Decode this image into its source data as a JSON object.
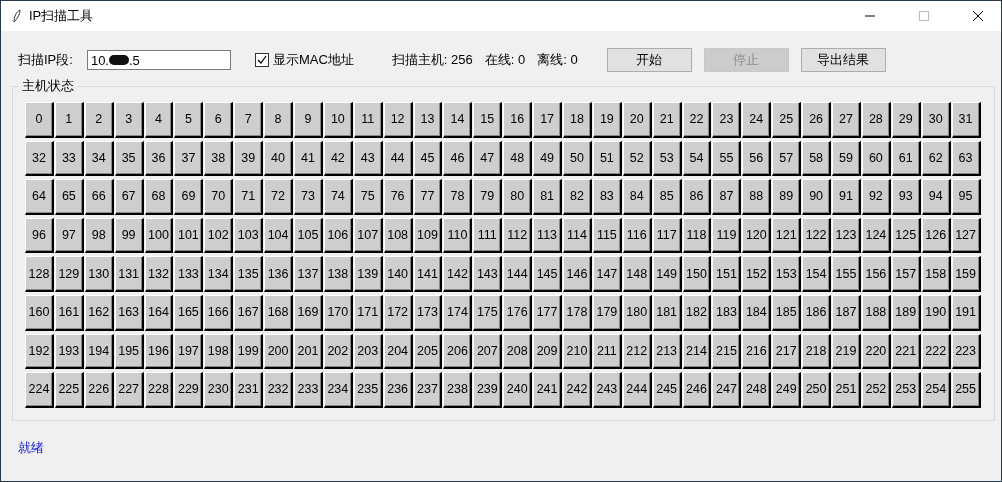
{
  "window": {
    "title": "IP扫描工具"
  },
  "toolbar": {
    "ip_label": "扫描IP段:",
    "ip_field": {
      "value_start": "10.",
      "redacted": true,
      "value_end": ".5"
    },
    "mac_checkbox": {
      "label": "显示MAC地址",
      "checked": true
    },
    "stats": [
      "扫描主机: 256",
      "在线: 0",
      "离线: 0"
    ],
    "buttons": [
      {
        "label": "开始",
        "disabled": false
      },
      {
        "label": "停止",
        "disabled": true
      },
      {
        "label": "导出结果",
        "disabled": false
      }
    ]
  },
  "host_group": {
    "title": "主机状态",
    "hosts": [
      "0",
      "1",
      "2",
      "3",
      "4",
      "5",
      "6",
      "7",
      "8",
      "9",
      "10",
      "11",
      "12",
      "13",
      "14",
      "15",
      "16",
      "17",
      "18",
      "19",
      "20",
      "21",
      "22",
      "23",
      "24",
      "25",
      "26",
      "27",
      "28",
      "29",
      "30",
      "31",
      "32",
      "33",
      "34",
      "35",
      "36",
      "37",
      "38",
      "39",
      "40",
      "41",
      "42",
      "43",
      "44",
      "45",
      "46",
      "47",
      "48",
      "49",
      "50",
      "51",
      "52",
      "53",
      "54",
      "55",
      "56",
      "57",
      "58",
      "59",
      "60",
      "61",
      "62",
      "63",
      "64",
      "65",
      "66",
      "67",
      "68",
      "69",
      "70",
      "71",
      "72",
      "73",
      "74",
      "75",
      "76",
      "77",
      "78",
      "79",
      "80",
      "81",
      "82",
      "83",
      "84",
      "85",
      "86",
      "87",
      "88",
      "89",
      "90",
      "91",
      "92",
      "93",
      "94",
      "95",
      "96",
      "97",
      "98",
      "99",
      "100",
      "101",
      "102",
      "103",
      "104",
      "105",
      "106",
      "107",
      "108",
      "109",
      "110",
      "111",
      "112",
      "113",
      "114",
      "115",
      "116",
      "117",
      "118",
      "119",
      "120",
      "121",
      "122",
      "123",
      "124",
      "125",
      "126",
      "127",
      "128",
      "129",
      "130",
      "131",
      "132",
      "133",
      "134",
      "135",
      "136",
      "137",
      "138",
      "139",
      "140",
      "141",
      "142",
      "143",
      "144",
      "145",
      "146",
      "147",
      "148",
      "149",
      "150",
      "151",
      "152",
      "153",
      "154",
      "155",
      "156",
      "157",
      "158",
      "159",
      "160",
      "161",
      "162",
      "163",
      "164",
      "165",
      "166",
      "167",
      "168",
      "169",
      "170",
      "171",
      "172",
      "173",
      "174",
      "175",
      "176",
      "177",
      "178",
      "179",
      "180",
      "181",
      "182",
      "183",
      "184",
      "185",
      "186",
      "187",
      "188",
      "189",
      "190",
      "191",
      "192",
      "193",
      "194",
      "195",
      "196",
      "197",
      "198",
      "199",
      "200",
      "201",
      "202",
      "203",
      "204",
      "205",
      "206",
      "207",
      "208",
      "209",
      "210",
      "211",
      "212",
      "213",
      "214",
      "215",
      "216",
      "217",
      "218",
      "219",
      "220",
      "221",
      "222",
      "223",
      "224",
      "225",
      "226",
      "227",
      "228",
      "229",
      "230",
      "231",
      "232",
      "233",
      "234",
      "235",
      "236",
      "237",
      "238",
      "239",
      "240",
      "241",
      "242",
      "243",
      "244",
      "245",
      "246",
      "247",
      "248",
      "249",
      "250",
      "251",
      "252",
      "253",
      "254",
      "255"
    ]
  },
  "status_bar": {
    "text": "就绪"
  }
}
